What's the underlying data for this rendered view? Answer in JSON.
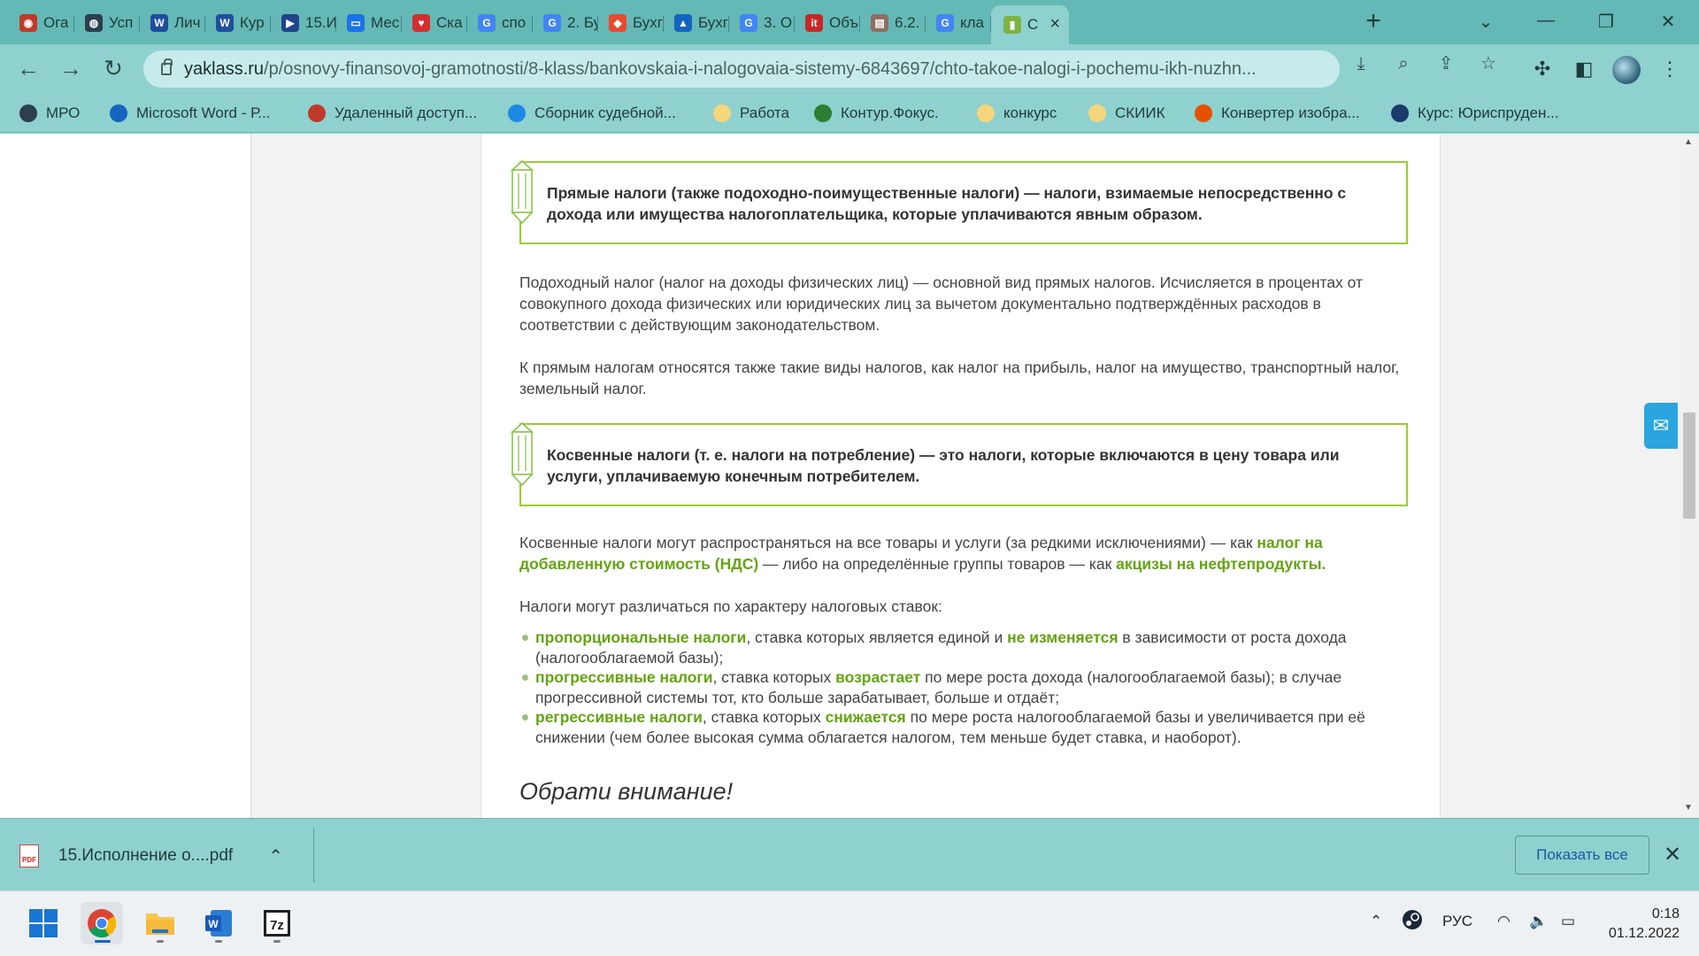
{
  "tabs": [
    {
      "label": "Ога",
      "color": "#c0392b",
      "glyph": "◉"
    },
    {
      "label": "Усп",
      "color": "#2c3e50",
      "glyph": "◍"
    },
    {
      "label": "Лич",
      "color": "#1f4e9c",
      "glyph": "W"
    },
    {
      "label": "Кур",
      "color": "#1f4e9c",
      "glyph": "W"
    },
    {
      "label": "15.И",
      "color": "#20438a",
      "glyph": "▶"
    },
    {
      "label": "Мес",
      "color": "#1a73e8",
      "glyph": "▭"
    },
    {
      "label": "Ска",
      "color": "#d32f2f",
      "glyph": "♥"
    },
    {
      "label": "спо",
      "color": "#4285f4",
      "glyph": "G"
    },
    {
      "label": "2. Бу",
      "color": "#4285f4",
      "glyph": "G"
    },
    {
      "label": "Бухг",
      "color": "#e84a2f",
      "glyph": "◆"
    },
    {
      "label": "Бухг",
      "color": "#1565c0",
      "glyph": "▲"
    },
    {
      "label": "3. О",
      "color": "#4285f4",
      "glyph": "G"
    },
    {
      "label": "Объ",
      "color": "#c62828",
      "glyph": "it"
    },
    {
      "label": "6.2.",
      "color": "#8d6e63",
      "glyph": "▤"
    },
    {
      "label": "кла",
      "color": "#4285f4",
      "glyph": "G"
    },
    {
      "label": "С",
      "color": "#7cb342",
      "glyph": "▮"
    }
  ],
  "address": {
    "host": "yaklass.ru",
    "path": "/p/osnovy-finansovoj-gramotnosti/8-klass/bankovskaia-i-nalogovaia-sistemy-6843697/chto-takoe-nalogi-i-pochemu-ikh-nuzhn..."
  },
  "bookmarks": [
    {
      "label": "МРО",
      "color": "#2c3e50"
    },
    {
      "label": "Microsoft Word - Р...",
      "color": "#1565c0"
    },
    {
      "label": "Удаленный доступ...",
      "color": "#c0392b"
    },
    {
      "label": "Сборник судебной...",
      "color": "#1e88e5"
    },
    {
      "label": "Работа",
      "color": "#f6d67a"
    },
    {
      "label": "Контур.Фокус.",
      "color": "#2e7d32"
    },
    {
      "label": "конкурс",
      "color": "#f6d67a"
    },
    {
      "label": "СКИИК",
      "color": "#f6d67a"
    },
    {
      "label": "Конвертер изобра...",
      "color": "#e65100"
    },
    {
      "label": "Курс: Юриспруден...",
      "color": "#1a3a6b"
    }
  ],
  "content": {
    "def1": "Прямые налоги (также подоходно-поимущественные налоги) — налоги, взимаемые непосредственно с дохода или имущества налогоплательщика, которые уплачиваются явным образом.",
    "p1": "Подоходный налог (налог на доходы физических лиц) — основной вид прямых налогов. Исчисляется в процентах от совокупного дохода физических или юридических лиц за вычетом документально подтверждённых расходов в соответствии с действующим законодательством.",
    "p2": "К прямым налогам относятся также такие виды налогов, как налог на прибыль, налог на имущество, транспортный налог, земельный налог.",
    "def2": "Косвенные налоги (т. е. налоги на потребление) — это налоги, которые включаются в цену товара или услуги, уплачиваемую конечным потребителем.",
    "p3_a": "Косвенные налоги могут распространяться на все товары и услуги (за редкими исключениями) — как ",
    "p3_b": "налог на добавленную стоимость (НДС)",
    "p3_c": " — либо на определённые группы товаров — как ",
    "p3_d": "акцизы на нефтепродукты",
    "p3_e": ".",
    "p4": "Налоги могут различаться по характеру налоговых ставок:",
    "b1_a": "пропорциональные налоги",
    "b1_b": ", ставка которых является единой и ",
    "b1_c": "не изменяется",
    "b1_d": " в зависимости от роста дохода (налогооблагаемой базы);",
    "b2_a": "прогрессивные налоги",
    "b2_b": ", ставка которых ",
    "b2_c": "возрастает",
    "b2_d": " по мере роста дохода (налогооблагаемой базы); в случае прогрессивной системы тот, кто больше зарабатывает, больше и отдаёт;",
    "b3_a": "регрессивные налоги",
    "b3_b": ", ставка которых ",
    "b3_c": "снижается",
    "b3_d": " по мере роста налогооблагаемой базы и увеличивается при её снижении (чем более высокая сумма облагается налогом, тем меньше будет ставка, и наоборот).",
    "note": "Обрати внимание!"
  },
  "downloads": {
    "file": "15.Исполнение о....pdf",
    "pdf_label": "PDF",
    "show_all": "Показать все"
  },
  "tray": {
    "lang": "РУС",
    "time": "0:18",
    "date": "01.12.2022"
  },
  "colors": {
    "accent_green": "#64a412",
    "box_border": "#9acd32",
    "chrome_bg": "#8fd1cf",
    "tab_strip": "#64b8b5"
  }
}
